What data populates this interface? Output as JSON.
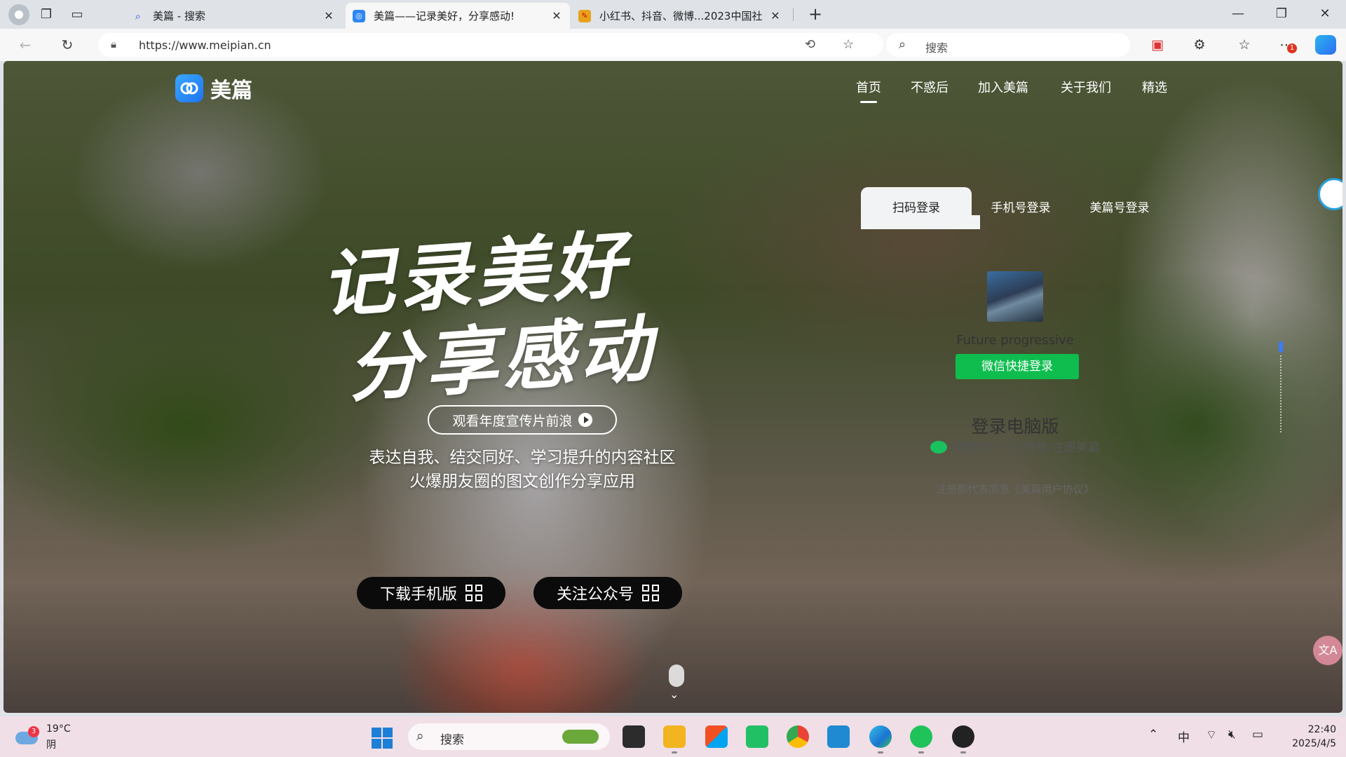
{
  "browser": {
    "tabs": [
      {
        "title": "美篇 - 搜索",
        "active": false
      },
      {
        "title": "美篇——记录美好，分享感动!",
        "active": true
      },
      {
        "title": "小红书、抖音、微博...2023中国社",
        "active": false
      }
    ],
    "url": "https://www.meipian.cn",
    "search_placeholder": "搜索",
    "notification_count": "1"
  },
  "site": {
    "logo_text": "美篇",
    "nav": [
      {
        "label": "首页",
        "active": true
      },
      {
        "label": "不惑后"
      },
      {
        "label": "加入美篇"
      },
      {
        "label": "关于我们"
      },
      {
        "label": "精选"
      }
    ],
    "hero_line1": "记录美好",
    "hero_line2": "分享感动",
    "promo_button": "观看年度宣传片前浪",
    "tagline1": "表达自我、结交同好、学习提升的内容社区",
    "tagline2": "火爆朋友圈的图文创作分享应用",
    "download_button": "下载手机版",
    "follow_button": "关注公众号",
    "translate_icon": "文A"
  },
  "login": {
    "tabs": [
      "扫码登录",
      "手机号登录",
      "美篇号登录"
    ],
    "active_tab": 0,
    "username": "Future progressive",
    "wechat_quick_login": "微信快捷登录",
    "pc_title": "登录电脑版",
    "pc_sub": "用微信扫一扫登录/注册美篇",
    "agreement": "注册即代表同意《美篇用户协议》"
  },
  "taskbar": {
    "weather_temp": "19°C",
    "weather_cond": "阴",
    "weather_badge": "3",
    "search_placeholder": "搜索",
    "ime": "中",
    "time": "22:40",
    "date": "2025/4/5"
  }
}
